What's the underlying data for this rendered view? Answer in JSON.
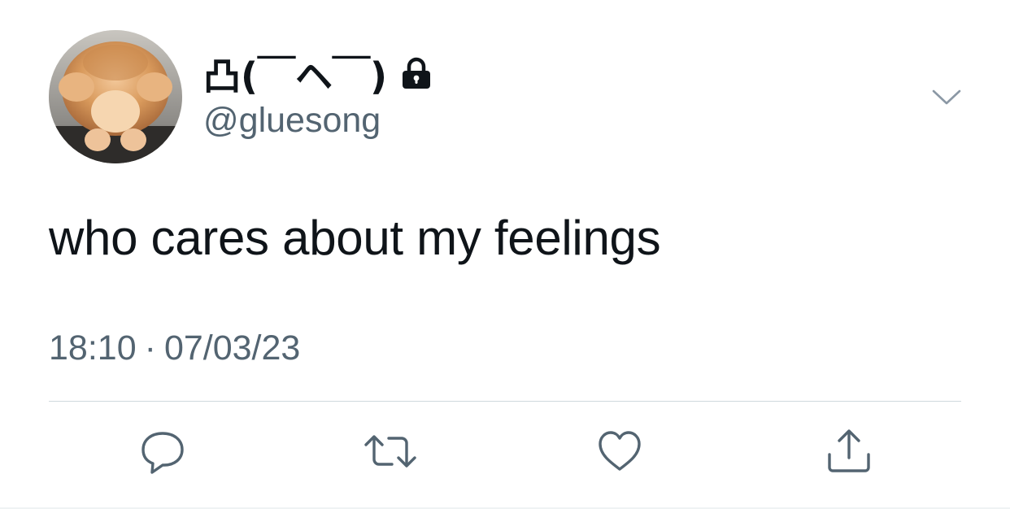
{
  "tweet": {
    "display_name": "凸(￣ヘ￣)",
    "handle": "@gluesong",
    "text": "who cares about my feelings",
    "time": "18:10",
    "separator": "·",
    "date": "07/03/23",
    "protected": true
  },
  "icons": {
    "lock": "lock-icon",
    "more": "chevron-down-icon",
    "reply": "reply-icon",
    "retweet": "retweet-icon",
    "like": "heart-icon",
    "share": "share-icon"
  },
  "colors": {
    "text": "#0f1419",
    "secondary": "#536471",
    "icon": "#536471",
    "divider": "#cfd9de"
  }
}
